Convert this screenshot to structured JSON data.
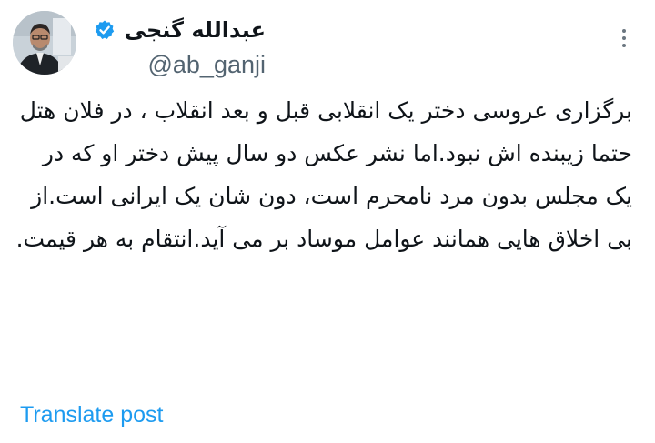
{
  "author": {
    "display_name": "عبدالله گنجی",
    "handle": "@ab_ganji",
    "verified": true
  },
  "post": {
    "text": "برگزاری عروسی دختر یک انقلابی قبل و بعد انقلاب ، در فلان هتل حتما زیبنده اش نبود.اما نشر عکس دو سال پیش دختر او که در یک مجلس بدون مرد نامحرم است، دون شان یک ایرانی است.از بی اخلاق هایی همانند عوامل موساد بر می آید.انتقام به هر قیمت."
  },
  "actions": {
    "translate_label": "Translate post"
  },
  "icons": {
    "more": "more-horizontal-icon",
    "verified": "verified-badge-icon"
  },
  "colors": {
    "accent": "#1d9bf0",
    "text": "#0f1419",
    "secondary_text": "#536471"
  }
}
